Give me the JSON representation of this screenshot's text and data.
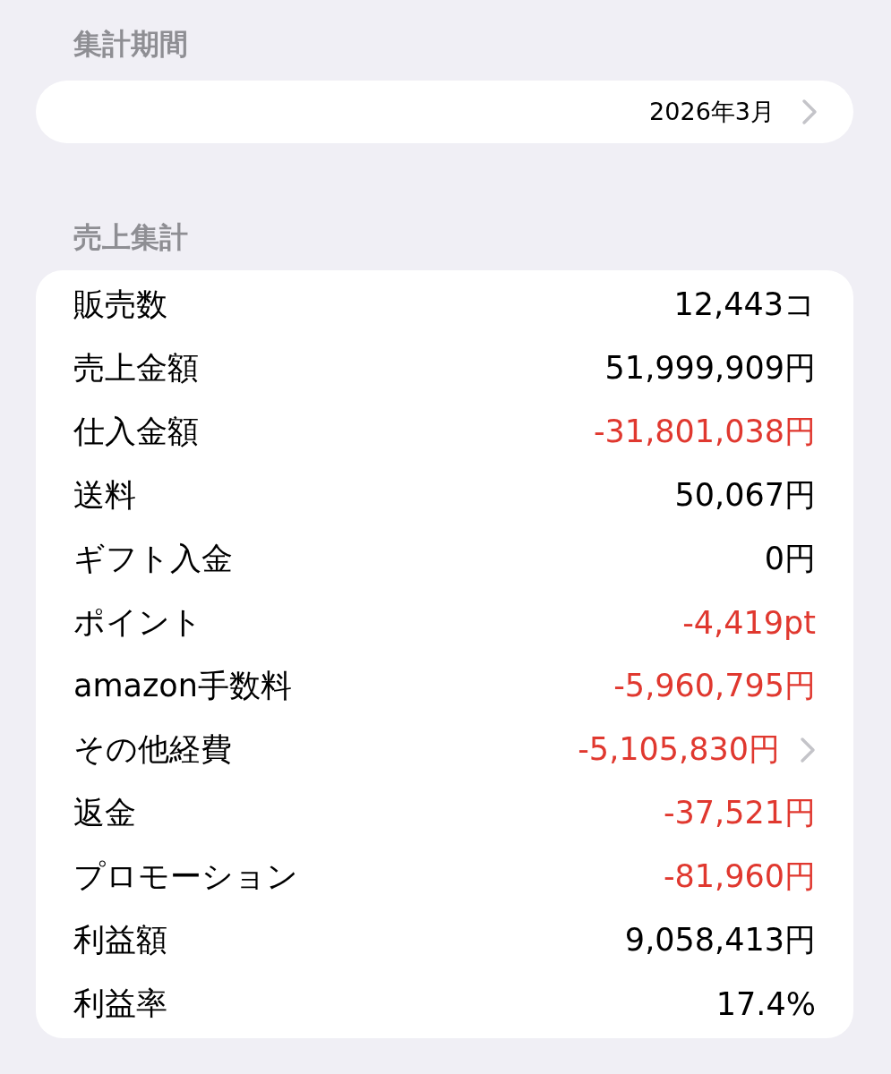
{
  "period_section": {
    "header": "集計期間",
    "value": "2026年3月",
    "disclosure": true
  },
  "sales_section": {
    "header": "売上集計",
    "rows": [
      {
        "label": "販売数",
        "value": "12,443コ",
        "negative": false,
        "disclosure": false
      },
      {
        "label": "売上金額",
        "value": "51,999,909円",
        "negative": false,
        "disclosure": false
      },
      {
        "label": "仕入金額",
        "value": "-31,801,038円",
        "negative": true,
        "disclosure": false
      },
      {
        "label": "送料",
        "value": "50,067円",
        "negative": false,
        "disclosure": false
      },
      {
        "label": "ギフト入金",
        "value": "0円",
        "negative": false,
        "disclosure": false
      },
      {
        "label": "ポイント",
        "value": "-4,419pt",
        "negative": true,
        "disclosure": false
      },
      {
        "label": "amazon手数料",
        "value": "-5,960,795円",
        "negative": true,
        "disclosure": false
      },
      {
        "label": "その他経費",
        "value": "-5,105,830円",
        "negative": true,
        "disclosure": true
      },
      {
        "label": "返金",
        "value": "-37,521円",
        "negative": true,
        "disclosure": false
      },
      {
        "label": "プロモーション",
        "value": "-81,960円",
        "negative": true,
        "disclosure": false
      },
      {
        "label": "利益額",
        "value": "9,058,413円",
        "negative": false,
        "disclosure": false
      },
      {
        "label": "利益率",
        "value": "17.4%",
        "negative": false,
        "disclosure": false
      }
    ]
  }
}
